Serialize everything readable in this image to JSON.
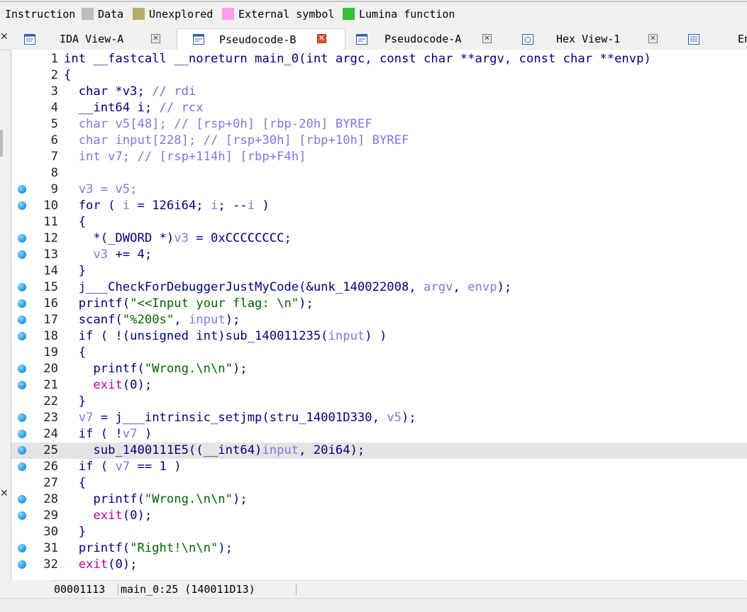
{
  "legend": {
    "items": [
      {
        "label": "Instruction",
        "color": ""
      },
      {
        "label": "Data",
        "color": "#bdbdbd"
      },
      {
        "label": "Unexplored",
        "color": "#b5ad6a"
      },
      {
        "label": "External symbol",
        "color": "#ff9cf0"
      },
      {
        "label": "Lumina function",
        "color": "#34c234"
      }
    ]
  },
  "tabs": [
    {
      "label": "IDA View-A",
      "icon": "ida-view-icon",
      "active": false
    },
    {
      "label": "Pseudocode-B",
      "icon": "pseudocode-icon",
      "active": true
    },
    {
      "label": "Pseudocode-A",
      "icon": "pseudocode-icon",
      "active": false
    },
    {
      "label": "Hex View-1",
      "icon": "hex-view-icon",
      "active": false
    },
    {
      "label": "En",
      "icon": "enums-icon",
      "active": false
    }
  ],
  "code_lines": [
    {
      "no": "1",
      "bp": false
    },
    {
      "no": "2",
      "bp": false
    },
    {
      "no": "3",
      "bp": false
    },
    {
      "no": "4",
      "bp": false
    },
    {
      "no": "5",
      "bp": false
    },
    {
      "no": "6",
      "bp": false
    },
    {
      "no": "7",
      "bp": false
    },
    {
      "no": "8",
      "bp": false
    },
    {
      "no": "9",
      "bp": true
    },
    {
      "no": "10",
      "bp": true
    },
    {
      "no": "11",
      "bp": false
    },
    {
      "no": "12",
      "bp": true
    },
    {
      "no": "13",
      "bp": true
    },
    {
      "no": "14",
      "bp": false
    },
    {
      "no": "15",
      "bp": true
    },
    {
      "no": "16",
      "bp": true
    },
    {
      "no": "17",
      "bp": true
    },
    {
      "no": "18",
      "bp": true
    },
    {
      "no": "19",
      "bp": false
    },
    {
      "no": "20",
      "bp": true
    },
    {
      "no": "21",
      "bp": true
    },
    {
      "no": "22",
      "bp": false
    },
    {
      "no": "23",
      "bp": true
    },
    {
      "no": "24",
      "bp": true
    },
    {
      "no": "25",
      "bp": true,
      "highlighted": true
    },
    {
      "no": "26",
      "bp": true
    },
    {
      "no": "27",
      "bp": false
    },
    {
      "no": "28",
      "bp": true
    },
    {
      "no": "29",
      "bp": true
    },
    {
      "no": "30",
      "bp": false
    },
    {
      "no": "31",
      "bp": true
    },
    {
      "no": "32",
      "bp": true
    }
  ],
  "code_text": [
    [
      [
        "k",
        "int __fastcall __noreturn main_0(int argc, const char **argv, const char **envp)"
      ]
    ],
    [
      [
        "k",
        "{"
      ]
    ],
    [
      [
        "k",
        "  char *v3; "
      ],
      [
        "c",
        "// rdi"
      ]
    ],
    [
      [
        "k",
        "  __int64 i; "
      ],
      [
        "c",
        "// rcx"
      ]
    ],
    [
      [
        "v",
        "  char v5[48]; // [rsp+0h] [rbp-20h] BYREF"
      ]
    ],
    [
      [
        "v",
        "  char input[228]; // [rsp+30h] [rbp+10h] BYREF"
      ]
    ],
    [
      [
        "v",
        "  int v7; // [rsp+114h] [rbp+F4h]"
      ]
    ],
    [
      [
        "k",
        ""
      ]
    ],
    [
      [
        "v",
        "  v3 = v5;"
      ]
    ],
    [
      [
        "k",
        "  for ( "
      ],
      [
        "v",
        "i"
      ],
      [
        "k",
        " = 126i64; "
      ],
      [
        "v",
        "i"
      ],
      [
        "k",
        "; --"
      ],
      [
        "v",
        "i"
      ],
      [
        "k",
        " )"
      ]
    ],
    [
      [
        "k",
        "  {"
      ]
    ],
    [
      [
        "k",
        "    *(_DWORD *)"
      ],
      [
        "v",
        "v3"
      ],
      [
        "k",
        " = 0xCCCCCCCC;"
      ]
    ],
    [
      [
        "v",
        "    v3"
      ],
      [
        "k",
        " += 4;"
      ]
    ],
    [
      [
        "k",
        "  }"
      ]
    ],
    [
      [
        "k",
        "  j___CheckForDebuggerJustMyCode(&unk_140022008, "
      ],
      [
        "v",
        "argv"
      ],
      [
        "k",
        ", "
      ],
      [
        "v",
        "envp"
      ],
      [
        "k",
        ");"
      ]
    ],
    [
      [
        "k",
        "  printf("
      ],
      [
        "s",
        "\"<<Input your flag: \\n\""
      ],
      [
        "k",
        ");"
      ]
    ],
    [
      [
        "k",
        "  scanf("
      ],
      [
        "s",
        "\"%200s\""
      ],
      [
        "k",
        ", "
      ],
      [
        "v",
        "input"
      ],
      [
        "k",
        ");"
      ]
    ],
    [
      [
        "k",
        "  if ( !(unsigned int)sub_140011235("
      ],
      [
        "v",
        "input"
      ],
      [
        "k",
        ") )"
      ]
    ],
    [
      [
        "k",
        "  {"
      ]
    ],
    [
      [
        "k",
        "    printf("
      ],
      [
        "s",
        "\"Wrong.\\n\\n\""
      ],
      [
        "k",
        ");"
      ]
    ],
    [
      [
        "r",
        "    exit"
      ],
      [
        "k",
        "(0);"
      ]
    ],
    [
      [
        "k",
        "  }"
      ]
    ],
    [
      [
        "v",
        "  v7"
      ],
      [
        "k",
        " = j___intrinsic_setjmp(stru_14001D330, "
      ],
      [
        "v",
        "v5"
      ],
      [
        "k",
        ");"
      ]
    ],
    [
      [
        "k",
        "  if ( !"
      ],
      [
        "v",
        "v7"
      ],
      [
        "k",
        " )"
      ]
    ],
    [
      [
        "k",
        "    sub_1400111E5((__int64)"
      ],
      [
        "v",
        "input"
      ],
      [
        "k",
        ", 20i64);"
      ]
    ],
    [
      [
        "k",
        "  if ( "
      ],
      [
        "v",
        "v7"
      ],
      [
        "k",
        " == 1 )"
      ]
    ],
    [
      [
        "k",
        "  {"
      ]
    ],
    [
      [
        "k",
        "    printf("
      ],
      [
        "s",
        "\"Wrong.\\n\\n\""
      ],
      [
        "k",
        ");"
      ]
    ],
    [
      [
        "r",
        "    exit"
      ],
      [
        "k",
        "(0);"
      ]
    ],
    [
      [
        "k",
        "  }"
      ]
    ],
    [
      [
        "k",
        "  printf("
      ],
      [
        "s",
        "\"Right!\\n\\n\""
      ],
      [
        "k",
        ");"
      ]
    ],
    [
      [
        "r",
        "  exit"
      ],
      [
        "k",
        "(0);"
      ]
    ]
  ],
  "status": {
    "address": "00001113",
    "location": "main_0:25 (140011D13)"
  }
}
